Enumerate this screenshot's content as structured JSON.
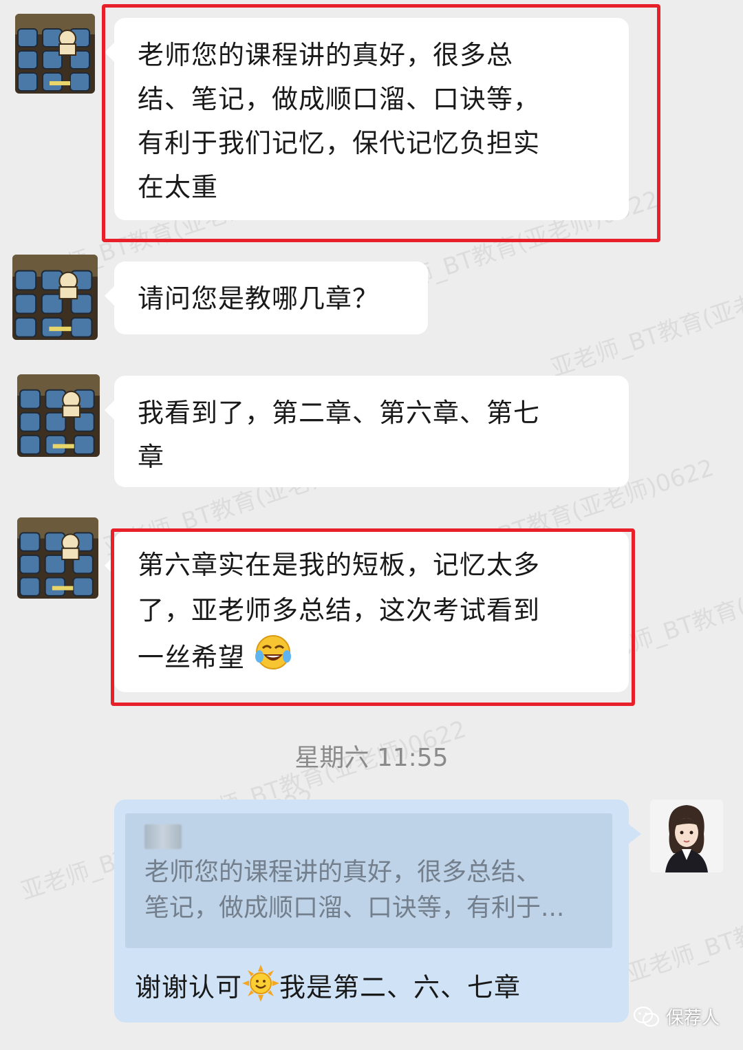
{
  "messages": [
    {
      "side": "left",
      "text_lines": [
        "老师您的课程讲的真好，很多总",
        "结、笔记，做成顺口溜、口诀等，",
        "有利于我们记忆，保代记忆负担实",
        "在太重"
      ],
      "highlighted": true
    },
    {
      "side": "left",
      "text_lines": [
        "请问您是教哪几章？"
      ],
      "highlighted": false
    },
    {
      "side": "left",
      "text_lines": [
        "我看到了，第二章、第六章、第七",
        "章"
      ],
      "highlighted": false
    },
    {
      "side": "left",
      "text_lines": [
        "第六章实在是我的短板，记忆太多",
        "了，亚老师多总结，这次考试看到",
        "一丝希望"
      ],
      "emoji": "tears-of-joy-emoji",
      "highlighted": true
    }
  ],
  "timestamp": "星期六  11:55",
  "reply": {
    "quote_lines": [
      "老师您的课程讲的真好，很多总结、",
      "笔记，做成顺口溜、口诀等，有利于..."
    ],
    "text_before": "谢谢认可",
    "emoji": "sun-emoji",
    "text_after": "我是第二、六、七章"
  },
  "watermark": "亚老师_BT教育(亚老师)0622",
  "footer_label": "保荐人",
  "colors": {
    "background": "#ededed",
    "bubble": "#ffffff",
    "self_bubble": "#cfe2f6",
    "highlight": "#e8202a"
  }
}
